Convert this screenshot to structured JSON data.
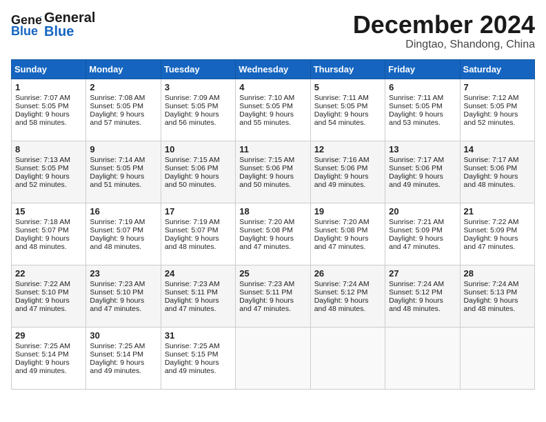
{
  "header": {
    "logo_line1": "General",
    "logo_line2": "Blue",
    "month_title": "December 2024",
    "location": "Dingtao, Shandong, China"
  },
  "days_of_week": [
    "Sunday",
    "Monday",
    "Tuesday",
    "Wednesday",
    "Thursday",
    "Friday",
    "Saturday"
  ],
  "weeks": [
    [
      {
        "day": "1",
        "lines": [
          "Sunrise: 7:07 AM",
          "Sunset: 5:05 PM",
          "Daylight: 9 hours",
          "and 58 minutes."
        ]
      },
      {
        "day": "2",
        "lines": [
          "Sunrise: 7:08 AM",
          "Sunset: 5:05 PM",
          "Daylight: 9 hours",
          "and 57 minutes."
        ]
      },
      {
        "day": "3",
        "lines": [
          "Sunrise: 7:09 AM",
          "Sunset: 5:05 PM",
          "Daylight: 9 hours",
          "and 56 minutes."
        ]
      },
      {
        "day": "4",
        "lines": [
          "Sunrise: 7:10 AM",
          "Sunset: 5:05 PM",
          "Daylight: 9 hours",
          "and 55 minutes."
        ]
      },
      {
        "day": "5",
        "lines": [
          "Sunrise: 7:11 AM",
          "Sunset: 5:05 PM",
          "Daylight: 9 hours",
          "and 54 minutes."
        ]
      },
      {
        "day": "6",
        "lines": [
          "Sunrise: 7:11 AM",
          "Sunset: 5:05 PM",
          "Daylight: 9 hours",
          "and 53 minutes."
        ]
      },
      {
        "day": "7",
        "lines": [
          "Sunrise: 7:12 AM",
          "Sunset: 5:05 PM",
          "Daylight: 9 hours",
          "and 52 minutes."
        ]
      }
    ],
    [
      {
        "day": "8",
        "lines": [
          "Sunrise: 7:13 AM",
          "Sunset: 5:05 PM",
          "Daylight: 9 hours",
          "and 52 minutes."
        ]
      },
      {
        "day": "9",
        "lines": [
          "Sunrise: 7:14 AM",
          "Sunset: 5:05 PM",
          "Daylight: 9 hours",
          "and 51 minutes."
        ]
      },
      {
        "day": "10",
        "lines": [
          "Sunrise: 7:15 AM",
          "Sunset: 5:06 PM",
          "Daylight: 9 hours",
          "and 50 minutes."
        ]
      },
      {
        "day": "11",
        "lines": [
          "Sunrise: 7:15 AM",
          "Sunset: 5:06 PM",
          "Daylight: 9 hours",
          "and 50 minutes."
        ]
      },
      {
        "day": "12",
        "lines": [
          "Sunrise: 7:16 AM",
          "Sunset: 5:06 PM",
          "Daylight: 9 hours",
          "and 49 minutes."
        ]
      },
      {
        "day": "13",
        "lines": [
          "Sunrise: 7:17 AM",
          "Sunset: 5:06 PM",
          "Daylight: 9 hours",
          "and 49 minutes."
        ]
      },
      {
        "day": "14",
        "lines": [
          "Sunrise: 7:17 AM",
          "Sunset: 5:06 PM",
          "Daylight: 9 hours",
          "and 48 minutes."
        ]
      }
    ],
    [
      {
        "day": "15",
        "lines": [
          "Sunrise: 7:18 AM",
          "Sunset: 5:07 PM",
          "Daylight: 9 hours",
          "and 48 minutes."
        ]
      },
      {
        "day": "16",
        "lines": [
          "Sunrise: 7:19 AM",
          "Sunset: 5:07 PM",
          "Daylight: 9 hours",
          "and 48 minutes."
        ]
      },
      {
        "day": "17",
        "lines": [
          "Sunrise: 7:19 AM",
          "Sunset: 5:07 PM",
          "Daylight: 9 hours",
          "and 48 minutes."
        ]
      },
      {
        "day": "18",
        "lines": [
          "Sunrise: 7:20 AM",
          "Sunset: 5:08 PM",
          "Daylight: 9 hours",
          "and 47 minutes."
        ]
      },
      {
        "day": "19",
        "lines": [
          "Sunrise: 7:20 AM",
          "Sunset: 5:08 PM",
          "Daylight: 9 hours",
          "and 47 minutes."
        ]
      },
      {
        "day": "20",
        "lines": [
          "Sunrise: 7:21 AM",
          "Sunset: 5:09 PM",
          "Daylight: 9 hours",
          "and 47 minutes."
        ]
      },
      {
        "day": "21",
        "lines": [
          "Sunrise: 7:22 AM",
          "Sunset: 5:09 PM",
          "Daylight: 9 hours",
          "and 47 minutes."
        ]
      }
    ],
    [
      {
        "day": "22",
        "lines": [
          "Sunrise: 7:22 AM",
          "Sunset: 5:10 PM",
          "Daylight: 9 hours",
          "and 47 minutes."
        ]
      },
      {
        "day": "23",
        "lines": [
          "Sunrise: 7:23 AM",
          "Sunset: 5:10 PM",
          "Daylight: 9 hours",
          "and 47 minutes."
        ]
      },
      {
        "day": "24",
        "lines": [
          "Sunrise: 7:23 AM",
          "Sunset: 5:11 PM",
          "Daylight: 9 hours",
          "and 47 minutes."
        ]
      },
      {
        "day": "25",
        "lines": [
          "Sunrise: 7:23 AM",
          "Sunset: 5:11 PM",
          "Daylight: 9 hours",
          "and 47 minutes."
        ]
      },
      {
        "day": "26",
        "lines": [
          "Sunrise: 7:24 AM",
          "Sunset: 5:12 PM",
          "Daylight: 9 hours",
          "and 48 minutes."
        ]
      },
      {
        "day": "27",
        "lines": [
          "Sunrise: 7:24 AM",
          "Sunset: 5:12 PM",
          "Daylight: 9 hours",
          "and 48 minutes."
        ]
      },
      {
        "day": "28",
        "lines": [
          "Sunrise: 7:24 AM",
          "Sunset: 5:13 PM",
          "Daylight: 9 hours",
          "and 48 minutes."
        ]
      }
    ],
    [
      {
        "day": "29",
        "lines": [
          "Sunrise: 7:25 AM",
          "Sunset: 5:14 PM",
          "Daylight: 9 hours",
          "and 49 minutes."
        ]
      },
      {
        "day": "30",
        "lines": [
          "Sunrise: 7:25 AM",
          "Sunset: 5:14 PM",
          "Daylight: 9 hours",
          "and 49 minutes."
        ]
      },
      {
        "day": "31",
        "lines": [
          "Sunrise: 7:25 AM",
          "Sunset: 5:15 PM",
          "Daylight: 9 hours",
          "and 49 minutes."
        ]
      },
      null,
      null,
      null,
      null
    ]
  ]
}
